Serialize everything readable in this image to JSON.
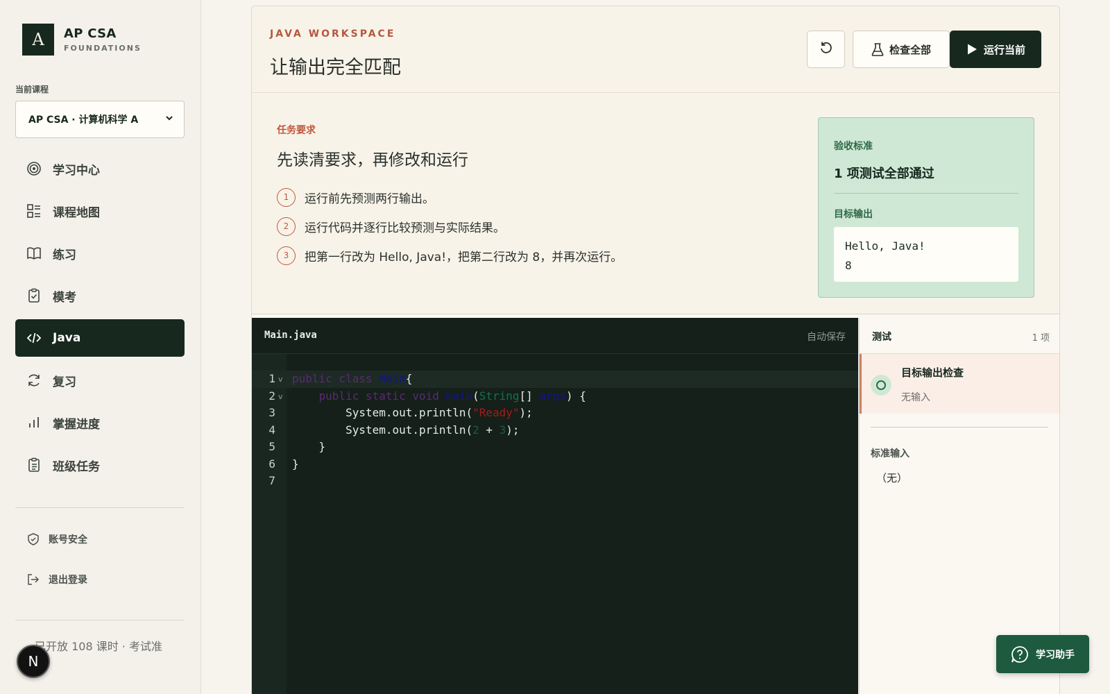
{
  "brand": {
    "logo": "A",
    "title": "AP CSA",
    "subtitle": "FOUNDATIONS"
  },
  "course": {
    "label": "当前课程",
    "selected": "AP CSA · 计算机科学 A"
  },
  "nav": [
    {
      "label": "学习中心",
      "icon": "target-icon"
    },
    {
      "label": "课程地图",
      "icon": "map-grid-icon"
    },
    {
      "label": "练习",
      "icon": "book-icon"
    },
    {
      "label": "模考",
      "icon": "clipboard-check-icon"
    },
    {
      "label": "Java",
      "icon": "code-icon",
      "active": true
    },
    {
      "label": "复习",
      "icon": "refresh-icon"
    },
    {
      "label": "掌握进度",
      "icon": "bar-chart-icon"
    },
    {
      "label": "班级任务",
      "icon": "clipboard-list-icon"
    }
  ],
  "account": [
    {
      "label": "账号安全",
      "icon": "shield-icon"
    },
    {
      "label": "退出登录",
      "icon": "logout-icon"
    }
  ],
  "footer_text": "已开放 108 课时 · 考试准",
  "avatar_letter": "N",
  "header": {
    "eyebrow": "JAVA WORKSPACE",
    "title": "让输出完全匹配",
    "check_all": "检查全部",
    "run_current": "运行当前"
  },
  "task": {
    "label": "任务要求",
    "title": "先读清要求，再修改和运行",
    "steps": [
      {
        "num": "1",
        "text": "运行前先预测两行输出。"
      },
      {
        "num": "2",
        "text": "运行代码并逐行比较预测与实际结果。"
      },
      {
        "num": "3",
        "text": "把第一行改为 Hello, Java!，把第二行改为 8，并再次运行。"
      }
    ]
  },
  "acceptance": {
    "label": "验收标准",
    "value": "1 项测试全部通过",
    "target_label": "目标输出",
    "target_lines": [
      "Hello, Java!",
      "8"
    ]
  },
  "editor": {
    "filename": "Main.java",
    "autosave": "自动保存",
    "lines": [
      {
        "n": "1",
        "fold": "v",
        "tokens": [
          [
            "kw",
            "public class "
          ],
          [
            "fn",
            "Main"
          ],
          [
            "",
            "{"
          ]
        ]
      },
      {
        "n": "2",
        "fold": "v",
        "tokens": [
          [
            "",
            "    "
          ],
          [
            "kw",
            "public static void "
          ],
          [
            "fn",
            "main"
          ],
          [
            "",
            "("
          ],
          [
            "ty",
            "String"
          ],
          [
            "",
            "[] "
          ],
          [
            "fn",
            "args"
          ],
          [
            "",
            ") {"
          ]
        ]
      },
      {
        "n": "3",
        "fold": "",
        "tokens": [
          [
            "",
            "        System.out.println("
          ],
          [
            "str",
            "\"Ready\""
          ],
          [
            "",
            ");"
          ]
        ]
      },
      {
        "n": "4",
        "fold": "",
        "tokens": [
          [
            "",
            "        System.out.println("
          ],
          [
            "num",
            "2"
          ],
          [
            "",
            " + "
          ],
          [
            "num",
            "3"
          ],
          [
            "",
            ");"
          ]
        ]
      },
      {
        "n": "5",
        "fold": "",
        "tokens": [
          [
            "",
            "    }"
          ]
        ]
      },
      {
        "n": "6",
        "fold": "",
        "tokens": [
          [
            "",
            "}"
          ]
        ]
      },
      {
        "n": "7",
        "fold": "",
        "tokens": []
      }
    ]
  },
  "tests": {
    "title": "测试",
    "count": "1 项",
    "items": [
      {
        "name": "目标输出检查",
        "sub": "无输入"
      }
    ],
    "stdin_label": "标准输入",
    "stdin_value": "（无）"
  },
  "helper": {
    "label": "学习助手"
  }
}
